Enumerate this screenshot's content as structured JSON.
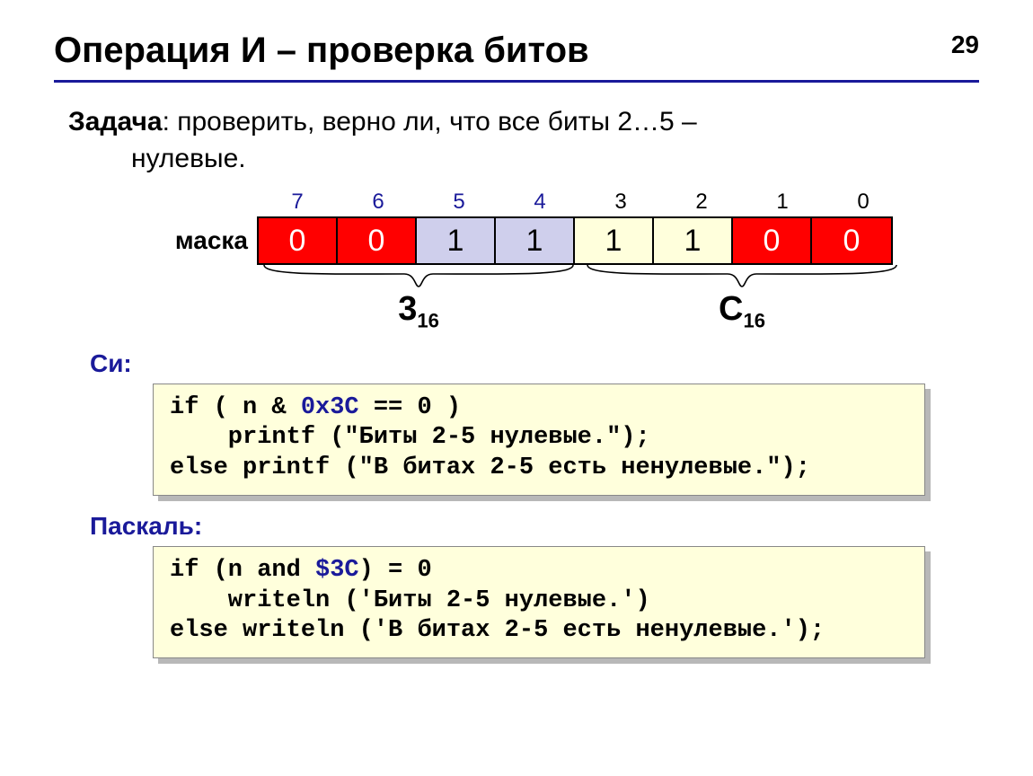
{
  "page_number": "29",
  "title": "Операция И – проверка битов",
  "task": {
    "label": "Задача",
    "line1_rest": ": проверить, верно ли, что все биты 2…5 –",
    "line2": "нулевые."
  },
  "bit_indices": [
    "7",
    "6",
    "5",
    "4",
    "3",
    "2",
    "1",
    "0"
  ],
  "bit_index_blue_count": 4,
  "mask_label": "маска",
  "mask_values": [
    "0",
    "0",
    "1",
    "1",
    "1",
    "1",
    "0",
    "0"
  ],
  "mask_colors": [
    "red",
    "red",
    "lav",
    "lav",
    "cream",
    "cream",
    "red",
    "red"
  ],
  "hex_left": {
    "main": "3",
    "sub": "16"
  },
  "hex_right": {
    "main": "C",
    "sub": "16"
  },
  "c_label": "Си:",
  "c_code": {
    "l1a": "if ( n & ",
    "l1b": "0x3C",
    "l1c": " == 0 )",
    "l2": "    printf (\"Биты 2-5 нулевые.\");",
    "l3": "else printf (\"В битах 2-5 есть ненулевые.\");"
  },
  "pascal_label": "Паскаль:",
  "pascal_code": {
    "l1a": "if (n and ",
    "l1b": "$3C",
    "l1c": ") = 0",
    "l2": "    writeln ('Биты 2-5 нулевые.')",
    "l3": "else writeln ('В битах 2-5 есть ненулевые.');"
  }
}
